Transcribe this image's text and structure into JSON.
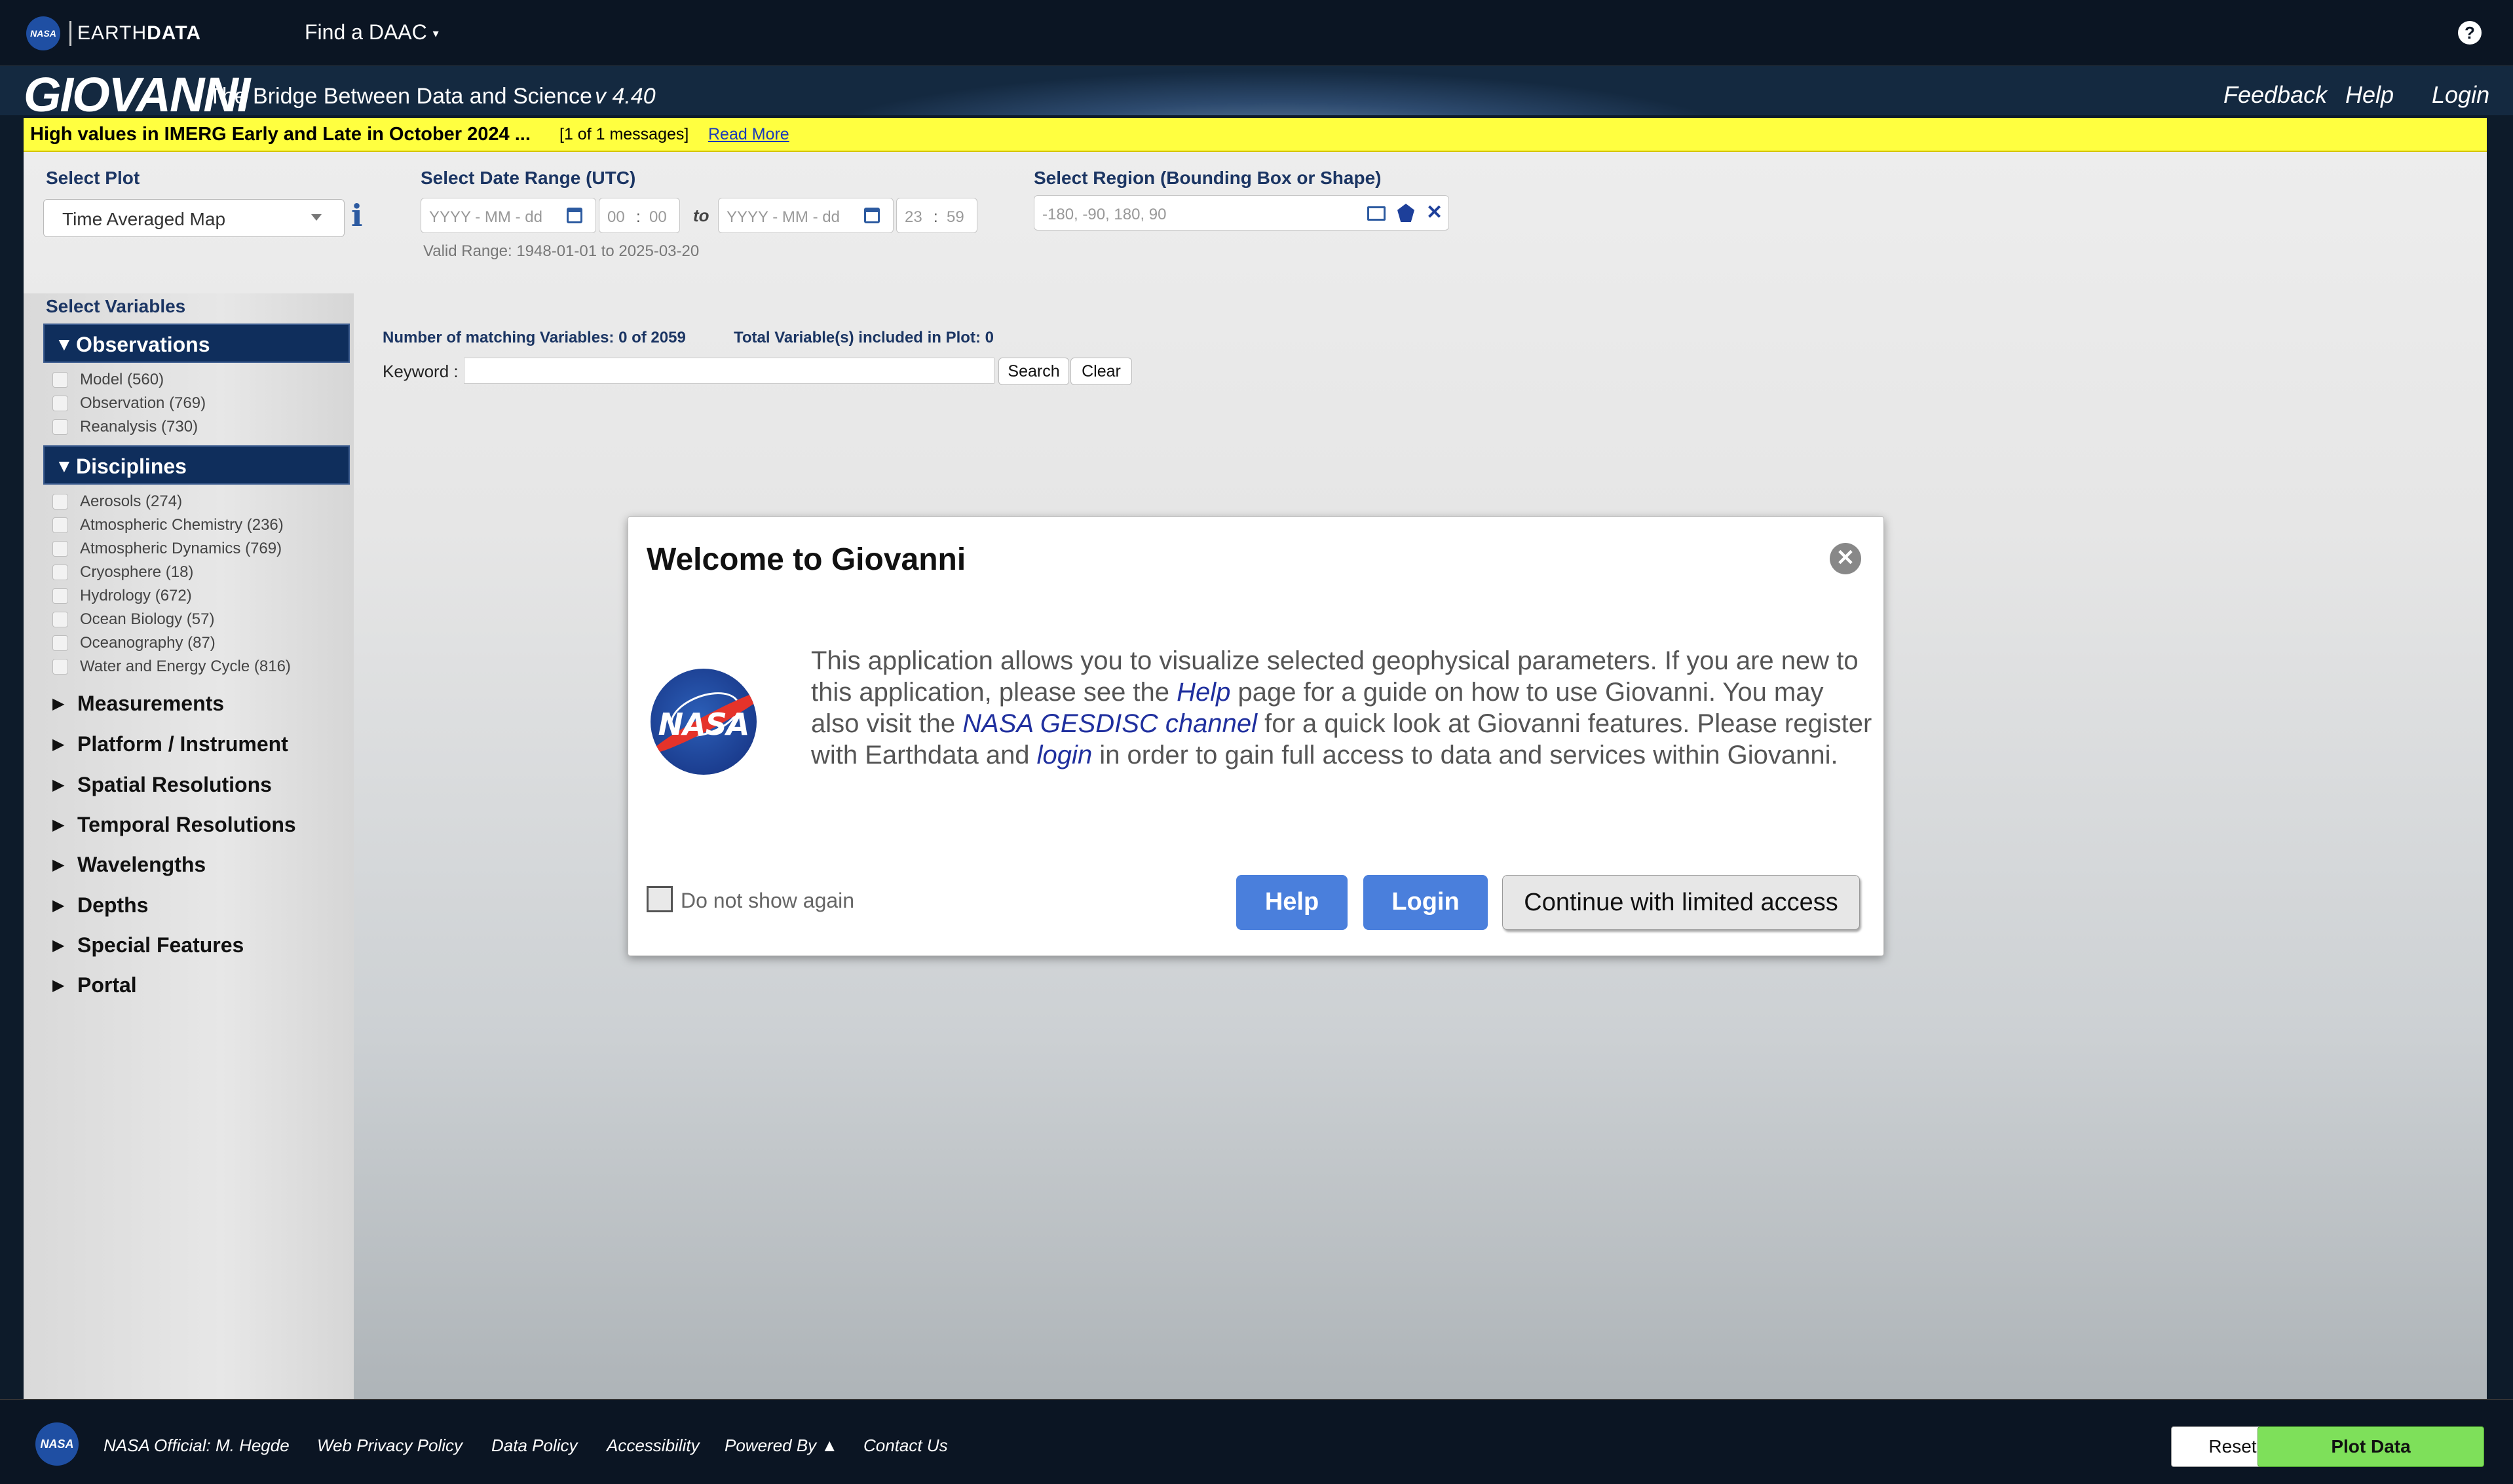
{
  "topbar": {
    "nasa_mini": "NASA",
    "brand_light": "EARTH",
    "brand_bold": "DATA",
    "find_daac": "Find a DAAC",
    "help_icon": "question-icon"
  },
  "header": {
    "logo": "GIOVANNI",
    "tagline": "The Bridge Between Data and Science",
    "version": "v 4.40",
    "nav": [
      "Feedback",
      "Help",
      "Login"
    ]
  },
  "alert": {
    "message": "High values in IMERG Early and Late in October 2024 ...",
    "count": "[1 of 1 messages]",
    "read_more": "Read More"
  },
  "plot": {
    "label": "Select Plot",
    "value": "Time Averaged Map"
  },
  "date_range": {
    "label": "Select Date Range (UTC)",
    "start_placeholder": "YYYY - MM - dd",
    "start_hour": "00",
    "start_min": "00",
    "to": "to",
    "end_placeholder": "YYYY - MM - dd",
    "end_hour": "23",
    "end_min": "59",
    "valid_range": "Valid Range: 1948-01-01 to 2025-03-20"
  },
  "region": {
    "label": "Select Region (Bounding Box or Shape)",
    "placeholder": "-180, -90, 180, 90"
  },
  "variables": {
    "label": "Select Variables",
    "observations": {
      "title": "Observations",
      "items": [
        "Model (560)",
        "Observation (769)",
        "Reanalysis (730)"
      ]
    },
    "disciplines": {
      "title": "Disciplines",
      "items": [
        "Aerosols (274)",
        "Atmospheric Chemistry (236)",
        "Atmospheric Dynamics (769)",
        "Cryosphere (18)",
        "Hydrology (672)",
        "Ocean Biology (57)",
        "Oceanography (87)",
        "Water and Energy Cycle (816)"
      ]
    },
    "collapsed": [
      "Measurements",
      "Platform / Instrument",
      "Spatial Resolutions",
      "Temporal Resolutions",
      "Wavelengths",
      "Depths",
      "Special Features",
      "Portal"
    ]
  },
  "search": {
    "matching": "Number of matching Variables: 0 of 2059",
    "total": "Total Variable(s) included in Plot: 0",
    "keyword_label": "Keyword :",
    "search_btn": "Search",
    "clear_btn": "Clear"
  },
  "modal": {
    "title": "Welcome to Giovanni",
    "logo_text": "NASA",
    "body_1": "This application allows you to visualize selected geophysical parameters. If you are new to this application, please see the ",
    "link_help": "Help",
    "body_2": " page for a guide on how to use Giovanni. You may also visit the ",
    "link_channel": "NASA GESDISC channel",
    "body_3": " for a quick look at Giovanni features. Please register with Earthdata and ",
    "link_login": "login",
    "body_4": " in order to gain full access to data and services within Giovanni.",
    "do_not_show": "Do not show again",
    "btn_help": "Help",
    "btn_login": "Login",
    "btn_continue": "Continue with limited access"
  },
  "footer": {
    "nasa_mini": "NASA",
    "links": [
      "NASA Official: M. Hegde",
      "Web Privacy Policy",
      "Data Policy",
      "Accessibility",
      "Powered By ▲",
      "Contact Us"
    ],
    "reset": "Reset",
    "plot": "Plot Data"
  }
}
